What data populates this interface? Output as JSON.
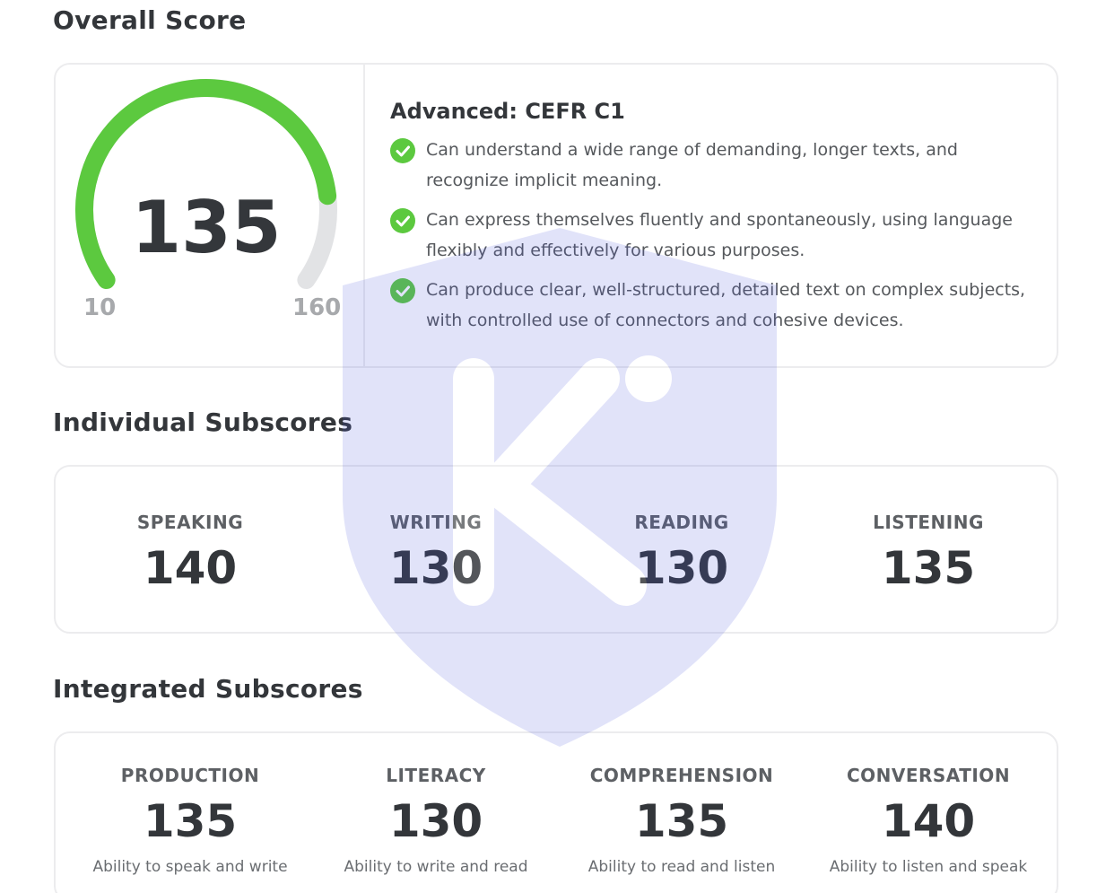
{
  "overall": {
    "title": "Overall Score",
    "score": "135",
    "min": "10",
    "max": "160",
    "score_value": 135,
    "range": [
      10,
      160
    ],
    "level_title": "Advanced: CEFR C1",
    "descriptions": [
      "Can understand a wide range of demanding, longer texts, and recognize implicit meaning.",
      "Can express themselves fluently and spontaneously, using language flexibly and effectively for various purposes.",
      "Can produce clear, well-structured, detailed text on complex subjects, with controlled use of connectors and cohesive devices."
    ]
  },
  "individual": {
    "title": "Individual Subscores",
    "items": [
      {
        "label": "SPEAKING",
        "score": "140"
      },
      {
        "label": "WRITING",
        "score": "130"
      },
      {
        "label": "READING",
        "score": "130"
      },
      {
        "label": "LISTENING",
        "score": "135"
      }
    ]
  },
  "integrated": {
    "title": "Integrated Subscores",
    "items": [
      {
        "label": "PRODUCTION",
        "score": "135",
        "desc": "Ability to speak and write"
      },
      {
        "label": "LITERACY",
        "score": "130",
        "desc": "Ability to write and read"
      },
      {
        "label": "COMPREHENSION",
        "score": "135",
        "desc": "Ability to read and listen"
      },
      {
        "label": "CONVERSATION",
        "score": "140",
        "desc": "Ability to listen and speak"
      }
    ]
  },
  "colors": {
    "gauge_fill": "#5cc93f",
    "gauge_track": "#e2e3e5",
    "check": "#5cc93f",
    "watermark": "#4a55e0"
  },
  "icons": {
    "check": "check-circle-icon",
    "watermark": "shield-logo-watermark"
  }
}
